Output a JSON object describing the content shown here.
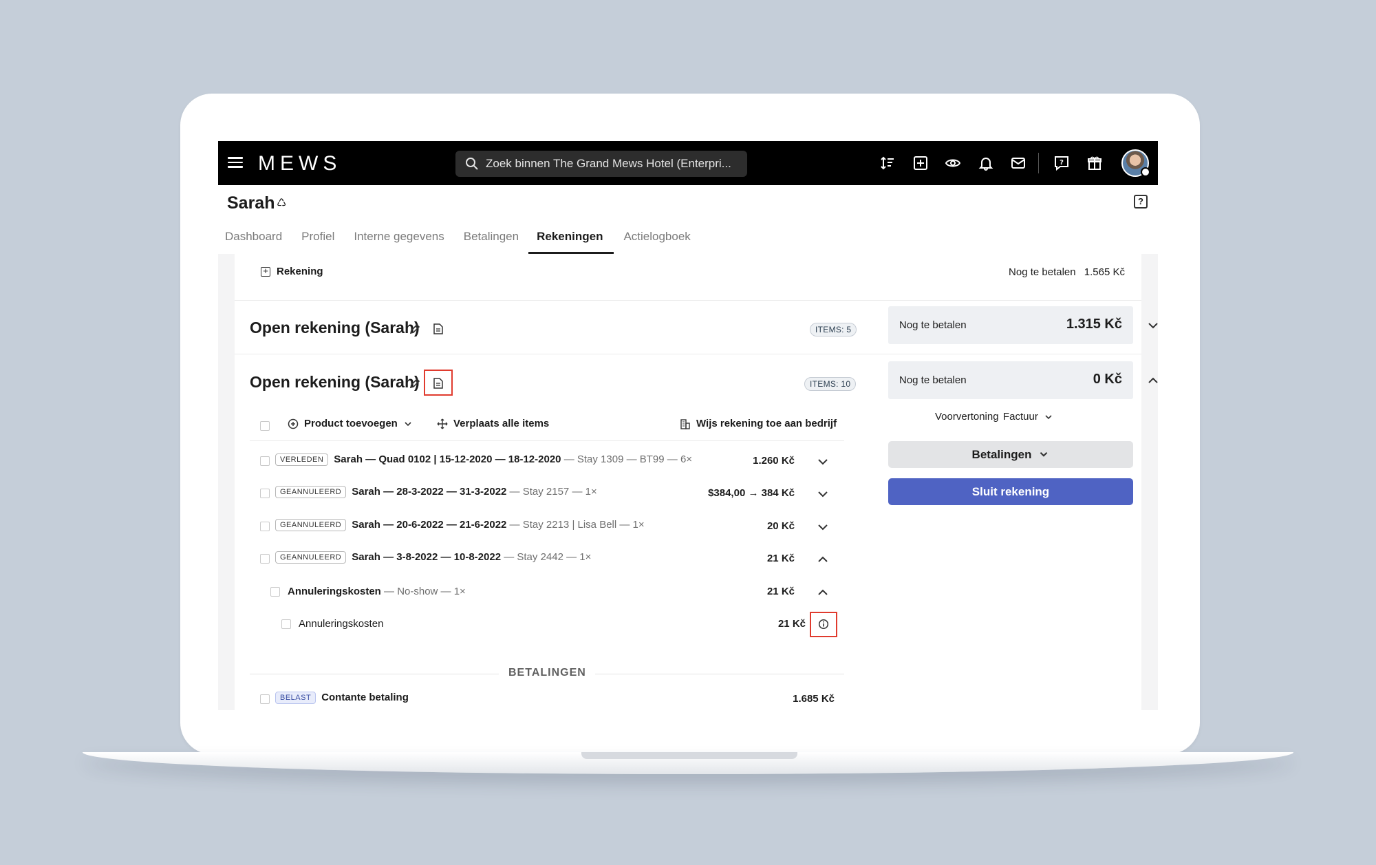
{
  "app": {
    "logo": "MEWS"
  },
  "search": {
    "placeholder": "Zoek binnen The Grand Mews Hotel (Enterpri..."
  },
  "header": {
    "title": "Sarah",
    "help": "?"
  },
  "tabs": [
    {
      "label": "Dashboard"
    },
    {
      "label": "Profiel"
    },
    {
      "label": "Interne gegevens"
    },
    {
      "label": "Betalingen"
    },
    {
      "label": "Rekeningen",
      "active": true
    },
    {
      "label": "Actielogboek"
    }
  ],
  "rekening_bar": {
    "add_label": "Rekening",
    "remaining_label": "Nog te betalen",
    "remaining_value": "1.565 Kč"
  },
  "bills": [
    {
      "title": "Open rekening (Sarah)",
      "items_badge": "ITEMS: 5",
      "summary_label": "Nog te betalen",
      "summary_value": "1.315 Kč",
      "expanded": false
    },
    {
      "title": "Open rekening (Sarah)",
      "items_badge": "ITEMS: 10",
      "summary_label": "Nog te betalen",
      "summary_value": "0 Kč",
      "expanded": true,
      "toolbar": {
        "add_product": "Product toevoegen",
        "move_all": "Verplaats alle items",
        "assign_company": "Wijs rekening toe aan bedrijf"
      },
      "actions": {
        "preview": "Voorvertoning",
        "invoice": "Factuur",
        "payments": "Betalingen",
        "close": "Sluit rekening"
      },
      "lines": [
        {
          "tag": "VERLEDEN",
          "main": "Sarah — Quad 0102 | 15-12-2020 — 18-12-2020",
          "muted": " — Stay 1309 — BT99 — 6×",
          "amount": "1.260 Kč"
        },
        {
          "tag": "GEANNULEERD",
          "main": "Sarah — 28-3-2022 — 31-3-2022",
          "muted": " — Stay 2157 — 1×",
          "amount": "$384,00 → 384 Kč"
        },
        {
          "tag": "GEANNULEERD",
          "main": "Sarah — 20-6-2022 — 21-6-2022",
          "muted": " — Stay 2213 | Lisa Bell — 1×",
          "amount": "20 Kč"
        },
        {
          "tag": "GEANNULEERD",
          "main": "Sarah — 3-8-2022 — 10-8-2022",
          "muted": " — Stay 2442 — 1×",
          "amount": "21 Kč"
        }
      ],
      "sub_line": {
        "main": "Annuleringskosten",
        "muted": " — No-show — 1×",
        "amount": "21 Kč"
      },
      "sub_sub_line": {
        "main": "Annuleringskosten",
        "amount": "21 Kč"
      },
      "payments_header": "BETALINGEN",
      "payment_line": {
        "tag": "BELAST",
        "main": "Contante betaling",
        "amount": "1.685 Kč"
      }
    }
  ],
  "colors": {
    "primary": "#4f63c3",
    "highlight": "#e03b2e",
    "topbar": "#000000",
    "background": "#c5ced9"
  }
}
